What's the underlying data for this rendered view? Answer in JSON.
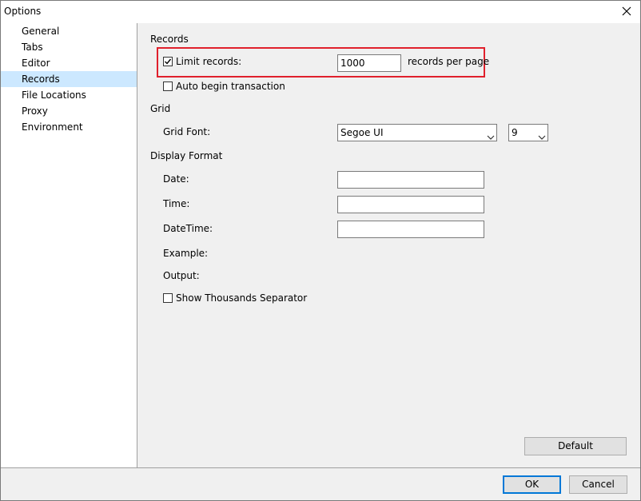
{
  "window": {
    "title": "Options"
  },
  "sidebar": {
    "items": [
      {
        "label": "General"
      },
      {
        "label": "Tabs"
      },
      {
        "label": "Editor"
      },
      {
        "label": "Records"
      },
      {
        "label": "File Locations"
      },
      {
        "label": "Proxy"
      },
      {
        "label": "Environment"
      }
    ],
    "selected": "Records"
  },
  "records": {
    "section_title": "Records",
    "limit_label": "Limit records:",
    "limit_checked": true,
    "limit_value": "1000",
    "per_page_label": "records per page",
    "auto_begin_label": "Auto begin transaction",
    "auto_begin_checked": false
  },
  "grid": {
    "section_title": "Grid",
    "font_label": "Grid Font:",
    "font_value": "Segoe UI",
    "size_value": "9"
  },
  "display_format": {
    "section_title": "Display Format",
    "date_label": "Date:",
    "date_value": "",
    "time_label": "Time:",
    "time_value": "",
    "datetime_label": "DateTime:",
    "datetime_value": "",
    "example_label": "Example:",
    "output_label": "Output:",
    "thousands_label": "Show Thousands Separator",
    "thousands_checked": false
  },
  "buttons": {
    "default": "Default",
    "ok": "OK",
    "cancel": "Cancel"
  },
  "colors": {
    "selection": "#cce8ff",
    "highlight_border": "#e0202c",
    "primary_border": "#0078d7"
  },
  "icons": {
    "close": "close-icon",
    "check": "checkmark-icon",
    "dropdown": "chevron-down-icon"
  }
}
